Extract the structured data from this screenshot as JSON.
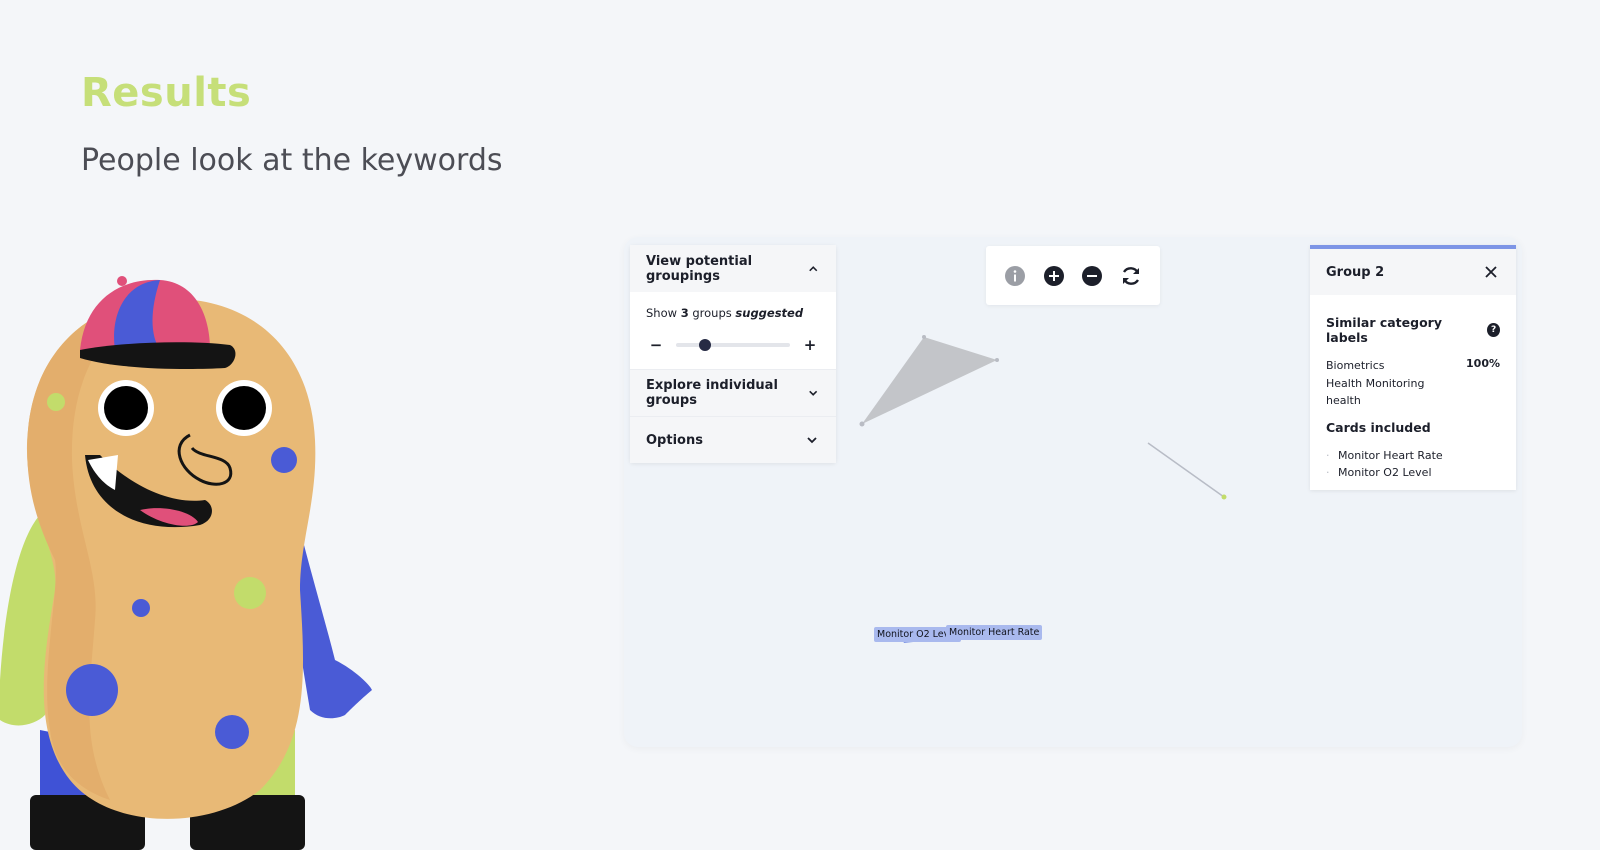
{
  "slide": {
    "title": "Results",
    "subtitle": "People look at the keywords"
  },
  "grouping_panel": {
    "header": "View potential groupings",
    "show_prefix": "Show",
    "groups_count": "3",
    "groups_word": "groups",
    "suggested": "suggested",
    "minus_label": "−",
    "plus_label": "+",
    "slider_value_fraction": 0.25,
    "explore_label": "Explore individual groups",
    "options_label": "Options"
  },
  "toolbar": {
    "icons": [
      "info-icon",
      "zoom-in-icon",
      "zoom-out-icon",
      "refresh-icon"
    ]
  },
  "group_panel": {
    "title": "Group 2",
    "similar_heading": "Similar category labels",
    "help_glyph": "?",
    "labels": [
      "Biometrics",
      "Health Monitoring",
      "health"
    ],
    "percent": "100%",
    "cards_heading": "Cards included",
    "cards": [
      "Monitor Heart Rate",
      "Monitor O2 Level"
    ]
  },
  "graph": {
    "nodes": [
      "Monitor O2 Level",
      "Monitor Heart Rate"
    ]
  },
  "colors": {
    "title": "#c6df79",
    "accent_bar": "#7d95e6",
    "node_label_bg": "#a9b9ee",
    "triangle": "#c3c5c9"
  }
}
